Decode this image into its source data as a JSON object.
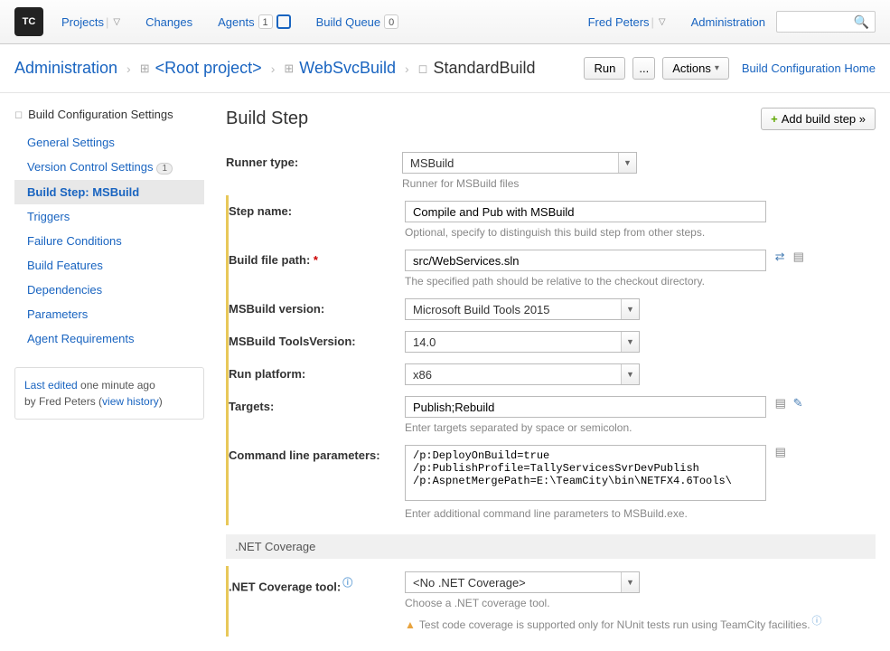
{
  "topnav": {
    "projects": "Projects",
    "changes": "Changes",
    "agents": "Agents",
    "agents_count": "1",
    "build_queue": "Build Queue",
    "build_queue_count": "0",
    "user": "Fred Peters",
    "admin": "Administration"
  },
  "breadcrumb": {
    "admin": "Administration",
    "root": "<Root project>",
    "project": "WebSvcBuild",
    "current": "StandardBuild",
    "run_btn": "Run",
    "ellipsis_btn": "...",
    "actions_btn": "Actions",
    "home_link": "Build Configuration Home"
  },
  "sidebar": {
    "title": "Build Configuration Settings",
    "items": [
      {
        "label": "General Settings"
      },
      {
        "label": "Version Control Settings",
        "badge": "1"
      },
      {
        "label": "Build Step: MSBuild",
        "active": true
      },
      {
        "label": "Triggers"
      },
      {
        "label": "Failure Conditions"
      },
      {
        "label": "Build Features"
      },
      {
        "label": "Dependencies"
      },
      {
        "label": "Parameters"
      },
      {
        "label": "Agent Requirements"
      }
    ],
    "footer": {
      "line1a": "Last edited",
      "line1b": " one minute ago",
      "line2a": "by Fred Peters  (",
      "line2b": "view history",
      "line2c": ")"
    }
  },
  "content": {
    "title": "Build Step",
    "add_step": "Add build step »",
    "runner_type": {
      "label": "Runner type:",
      "value": "MSBuild",
      "help": "Runner for MSBuild files"
    },
    "step_name": {
      "label": "Step name:",
      "value": "Compile and Pub with MSBuild",
      "help": "Optional, specify to distinguish this build step from other steps."
    },
    "build_file": {
      "label": "Build file path:",
      "value": "src/WebServices.sln",
      "help": "The specified path should be relative to the checkout directory."
    },
    "msbuild_version": {
      "label": "MSBuild version:",
      "value": "Microsoft Build Tools 2015"
    },
    "tools_version": {
      "label": "MSBuild ToolsVersion:",
      "value": "14.0"
    },
    "run_platform": {
      "label": "Run platform:",
      "value": "x86"
    },
    "targets": {
      "label": "Targets:",
      "value": "Publish;Rebuild",
      "help": "Enter targets separated by space or semicolon."
    },
    "cmd_params": {
      "label": "Command line parameters:",
      "value": "/p:DeployOnBuild=true\n/p:PublishProfile=TallyServicesSvrDevPublish\n/p:AspnetMergePath=E:\\TeamCity\\bin\\NETFX4.6Tools\\",
      "help": "Enter additional command line parameters to MSBuild.exe."
    },
    "coverage_section": ".NET Coverage",
    "coverage_tool": {
      "label": ".NET Coverage tool:",
      "value": "<No .NET Coverage>",
      "help": "Choose a .NET coverage tool.",
      "warn": "Test code coverage is supported only for NUnit tests run using TeamCity facilities."
    }
  }
}
